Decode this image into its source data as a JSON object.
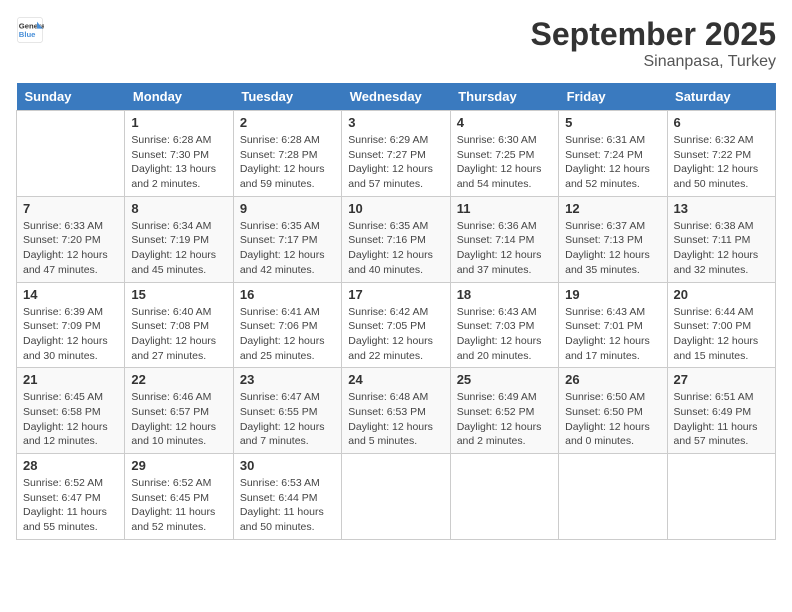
{
  "header": {
    "logo_line1": "General",
    "logo_line2": "Blue",
    "month": "September 2025",
    "location": "Sinanpasa, Turkey"
  },
  "days_of_week": [
    "Sunday",
    "Monday",
    "Tuesday",
    "Wednesday",
    "Thursday",
    "Friday",
    "Saturday"
  ],
  "weeks": [
    [
      {
        "day": "",
        "sunrise": "",
        "sunset": "",
        "daylight": ""
      },
      {
        "day": "1",
        "sunrise": "Sunrise: 6:28 AM",
        "sunset": "Sunset: 7:30 PM",
        "daylight": "Daylight: 13 hours and 2 minutes."
      },
      {
        "day": "2",
        "sunrise": "Sunrise: 6:28 AM",
        "sunset": "Sunset: 7:28 PM",
        "daylight": "Daylight: 12 hours and 59 minutes."
      },
      {
        "day": "3",
        "sunrise": "Sunrise: 6:29 AM",
        "sunset": "Sunset: 7:27 PM",
        "daylight": "Daylight: 12 hours and 57 minutes."
      },
      {
        "day": "4",
        "sunrise": "Sunrise: 6:30 AM",
        "sunset": "Sunset: 7:25 PM",
        "daylight": "Daylight: 12 hours and 54 minutes."
      },
      {
        "day": "5",
        "sunrise": "Sunrise: 6:31 AM",
        "sunset": "Sunset: 7:24 PM",
        "daylight": "Daylight: 12 hours and 52 minutes."
      },
      {
        "day": "6",
        "sunrise": "Sunrise: 6:32 AM",
        "sunset": "Sunset: 7:22 PM",
        "daylight": "Daylight: 12 hours and 50 minutes."
      }
    ],
    [
      {
        "day": "7",
        "sunrise": "Sunrise: 6:33 AM",
        "sunset": "Sunset: 7:20 PM",
        "daylight": "Daylight: 12 hours and 47 minutes."
      },
      {
        "day": "8",
        "sunrise": "Sunrise: 6:34 AM",
        "sunset": "Sunset: 7:19 PM",
        "daylight": "Daylight: 12 hours and 45 minutes."
      },
      {
        "day": "9",
        "sunrise": "Sunrise: 6:35 AM",
        "sunset": "Sunset: 7:17 PM",
        "daylight": "Daylight: 12 hours and 42 minutes."
      },
      {
        "day": "10",
        "sunrise": "Sunrise: 6:35 AM",
        "sunset": "Sunset: 7:16 PM",
        "daylight": "Daylight: 12 hours and 40 minutes."
      },
      {
        "day": "11",
        "sunrise": "Sunrise: 6:36 AM",
        "sunset": "Sunset: 7:14 PM",
        "daylight": "Daylight: 12 hours and 37 minutes."
      },
      {
        "day": "12",
        "sunrise": "Sunrise: 6:37 AM",
        "sunset": "Sunset: 7:13 PM",
        "daylight": "Daylight: 12 hours and 35 minutes."
      },
      {
        "day": "13",
        "sunrise": "Sunrise: 6:38 AM",
        "sunset": "Sunset: 7:11 PM",
        "daylight": "Daylight: 12 hours and 32 minutes."
      }
    ],
    [
      {
        "day": "14",
        "sunrise": "Sunrise: 6:39 AM",
        "sunset": "Sunset: 7:09 PM",
        "daylight": "Daylight: 12 hours and 30 minutes."
      },
      {
        "day": "15",
        "sunrise": "Sunrise: 6:40 AM",
        "sunset": "Sunset: 7:08 PM",
        "daylight": "Daylight: 12 hours and 27 minutes."
      },
      {
        "day": "16",
        "sunrise": "Sunrise: 6:41 AM",
        "sunset": "Sunset: 7:06 PM",
        "daylight": "Daylight: 12 hours and 25 minutes."
      },
      {
        "day": "17",
        "sunrise": "Sunrise: 6:42 AM",
        "sunset": "Sunset: 7:05 PM",
        "daylight": "Daylight: 12 hours and 22 minutes."
      },
      {
        "day": "18",
        "sunrise": "Sunrise: 6:43 AM",
        "sunset": "Sunset: 7:03 PM",
        "daylight": "Daylight: 12 hours and 20 minutes."
      },
      {
        "day": "19",
        "sunrise": "Sunrise: 6:43 AM",
        "sunset": "Sunset: 7:01 PM",
        "daylight": "Daylight: 12 hours and 17 minutes."
      },
      {
        "day": "20",
        "sunrise": "Sunrise: 6:44 AM",
        "sunset": "Sunset: 7:00 PM",
        "daylight": "Daylight: 12 hours and 15 minutes."
      }
    ],
    [
      {
        "day": "21",
        "sunrise": "Sunrise: 6:45 AM",
        "sunset": "Sunset: 6:58 PM",
        "daylight": "Daylight: 12 hours and 12 minutes."
      },
      {
        "day": "22",
        "sunrise": "Sunrise: 6:46 AM",
        "sunset": "Sunset: 6:57 PM",
        "daylight": "Daylight: 12 hours and 10 minutes."
      },
      {
        "day": "23",
        "sunrise": "Sunrise: 6:47 AM",
        "sunset": "Sunset: 6:55 PM",
        "daylight": "Daylight: 12 hours and 7 minutes."
      },
      {
        "day": "24",
        "sunrise": "Sunrise: 6:48 AM",
        "sunset": "Sunset: 6:53 PM",
        "daylight": "Daylight: 12 hours and 5 minutes."
      },
      {
        "day": "25",
        "sunrise": "Sunrise: 6:49 AM",
        "sunset": "Sunset: 6:52 PM",
        "daylight": "Daylight: 12 hours and 2 minutes."
      },
      {
        "day": "26",
        "sunrise": "Sunrise: 6:50 AM",
        "sunset": "Sunset: 6:50 PM",
        "daylight": "Daylight: 12 hours and 0 minutes."
      },
      {
        "day": "27",
        "sunrise": "Sunrise: 6:51 AM",
        "sunset": "Sunset: 6:49 PM",
        "daylight": "Daylight: 11 hours and 57 minutes."
      }
    ],
    [
      {
        "day": "28",
        "sunrise": "Sunrise: 6:52 AM",
        "sunset": "Sunset: 6:47 PM",
        "daylight": "Daylight: 11 hours and 55 minutes."
      },
      {
        "day": "29",
        "sunrise": "Sunrise: 6:52 AM",
        "sunset": "Sunset: 6:45 PM",
        "daylight": "Daylight: 11 hours and 52 minutes."
      },
      {
        "day": "30",
        "sunrise": "Sunrise: 6:53 AM",
        "sunset": "Sunset: 6:44 PM",
        "daylight": "Daylight: 11 hours and 50 minutes."
      },
      {
        "day": "",
        "sunrise": "",
        "sunset": "",
        "daylight": ""
      },
      {
        "day": "",
        "sunrise": "",
        "sunset": "",
        "daylight": ""
      },
      {
        "day": "",
        "sunrise": "",
        "sunset": "",
        "daylight": ""
      },
      {
        "day": "",
        "sunrise": "",
        "sunset": "",
        "daylight": ""
      }
    ]
  ]
}
